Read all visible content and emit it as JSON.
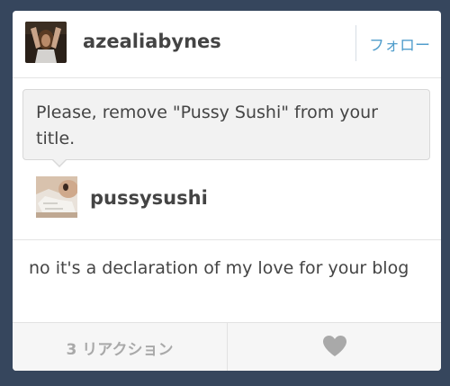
{
  "post": {
    "author": {
      "username": "azealiabynes",
      "avatar_icon": "profile-photo"
    },
    "follow_label": "フォロー",
    "question": {
      "text": "Please, remove \"Pussy Sushi\" from your title.",
      "asker": {
        "username": "pussysushi",
        "avatar_icon": "profile-photo"
      }
    },
    "answer": {
      "text": "no it's a declaration of my love for your blog"
    },
    "footer": {
      "notes_label": "3 リアクション",
      "like_icon": "heart-icon"
    }
  },
  "colors": {
    "background": "#36465d",
    "link": "#529ecc",
    "text": "#444444"
  }
}
